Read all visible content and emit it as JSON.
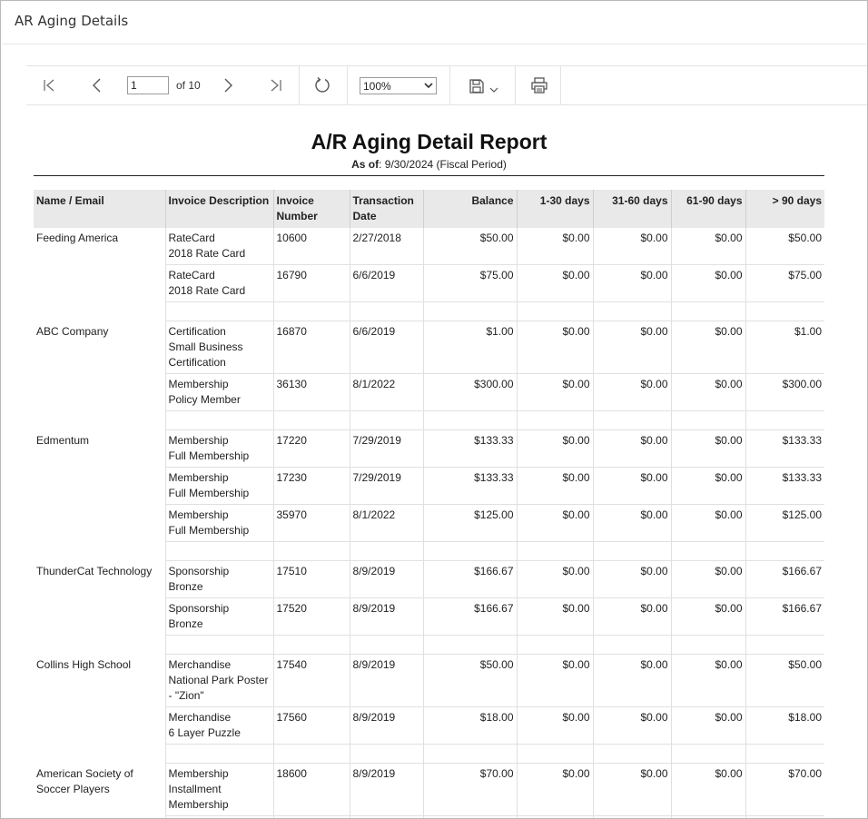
{
  "window": {
    "title": "AR Aging Details"
  },
  "toolbar": {
    "current_page": "1",
    "page_of": "of 10",
    "zoom": "100%",
    "icons": [
      "first-page-icon",
      "prev-page-icon",
      "next-page-icon",
      "last-page-icon",
      "refresh-icon",
      "save-icon",
      "chevron-down-icon",
      "print-icon"
    ]
  },
  "report": {
    "title": "A/R Aging Detail Report",
    "asof_label": "As of",
    "asof_value": ": 9/30/2024 (Fiscal Period)"
  },
  "table": {
    "headers": {
      "name": "Name / Email",
      "desc": "Invoice Description",
      "invoice_1": "Invoice",
      "invoice_2": "Number",
      "trans_1": "Transaction",
      "trans_2": "Date",
      "balance": "Balance",
      "d1_30": "1-30 days",
      "d31_60": "31-60 days",
      "d61_90": "61-90 days",
      "d90p": "> 90 days"
    },
    "groups": [
      {
        "name": "Feeding America",
        "rows": [
          {
            "desc": [
              "RateCard",
              "2018 Rate Card"
            ],
            "invoice": "10600",
            "date": "2/27/2018",
            "balance": "$50.00",
            "d1_30": "$0.00",
            "d31_60": "$0.00",
            "d61_90": "$0.00",
            "d90p": "$50.00"
          },
          {
            "desc": [
              "RateCard",
              "2018 Rate Card"
            ],
            "invoice": "16790",
            "date": "6/6/2019",
            "balance": "$75.00",
            "d1_30": "$0.00",
            "d31_60": "$0.00",
            "d61_90": "$0.00",
            "d90p": "$75.00"
          }
        ]
      },
      {
        "name": "ABC Company",
        "rows": [
          {
            "desc": [
              "Certification",
              "Small Business",
              "Certification"
            ],
            "invoice": "16870",
            "date": "6/6/2019",
            "balance": "$1.00",
            "d1_30": "$0.00",
            "d31_60": "$0.00",
            "d61_90": "$0.00",
            "d90p": "$1.00"
          },
          {
            "desc": [
              "Membership",
              "Policy Member"
            ],
            "invoice": "36130",
            "date": "8/1/2022",
            "balance": "$300.00",
            "d1_30": "$0.00",
            "d31_60": "$0.00",
            "d61_90": "$0.00",
            "d90p": "$300.00"
          }
        ]
      },
      {
        "name": "Edmentum",
        "rows": [
          {
            "desc": [
              "Membership",
              "Full Membership"
            ],
            "invoice": "17220",
            "date": "7/29/2019",
            "balance": "$133.33",
            "d1_30": "$0.00",
            "d31_60": "$0.00",
            "d61_90": "$0.00",
            "d90p": "$133.33"
          },
          {
            "desc": [
              "Membership",
              "Full Membership"
            ],
            "invoice": "17230",
            "date": "7/29/2019",
            "balance": "$133.33",
            "d1_30": "$0.00",
            "d31_60": "$0.00",
            "d61_90": "$0.00",
            "d90p": "$133.33"
          },
          {
            "desc": [
              "Membership",
              "Full Membership"
            ],
            "invoice": "35970",
            "date": "8/1/2022",
            "balance": "$125.00",
            "d1_30": "$0.00",
            "d31_60": "$0.00",
            "d61_90": "$0.00",
            "d90p": "$125.00"
          }
        ]
      },
      {
        "name": "ThunderCat Technology",
        "rows": [
          {
            "desc": [
              "Sponsorship",
              "Bronze"
            ],
            "invoice": "17510",
            "date": "8/9/2019",
            "balance": "$166.67",
            "d1_30": "$0.00",
            "d31_60": "$0.00",
            "d61_90": "$0.00",
            "d90p": "$166.67"
          },
          {
            "desc": [
              "Sponsorship",
              "Bronze"
            ],
            "invoice": "17520",
            "date": "8/9/2019",
            "balance": "$166.67",
            "d1_30": "$0.00",
            "d31_60": "$0.00",
            "d61_90": "$0.00",
            "d90p": "$166.67"
          }
        ]
      },
      {
        "name": "Collins High School",
        "rows": [
          {
            "desc": [
              "Merchandise",
              "National Park Poster",
              "- \"Zion\""
            ],
            "invoice": "17540",
            "date": "8/9/2019",
            "balance": "$50.00",
            "d1_30": "$0.00",
            "d31_60": "$0.00",
            "d61_90": "$0.00",
            "d90p": "$50.00"
          },
          {
            "desc": [
              "Merchandise",
              "6 Layer Puzzle"
            ],
            "invoice": "17560",
            "date": "8/9/2019",
            "balance": "$18.00",
            "d1_30": "$0.00",
            "d31_60": "$0.00",
            "d61_90": "$0.00",
            "d90p": "$18.00"
          }
        ]
      },
      {
        "name": "American Society of Soccer Players",
        "rows": [
          {
            "desc": [
              "Membership",
              "Installment",
              "Membership"
            ],
            "invoice": "18600",
            "date": "8/9/2019",
            "balance": "$70.00",
            "d1_30": "$0.00",
            "d31_60": "$0.00",
            "d61_90": "$0.00",
            "d90p": "$70.00"
          }
        ]
      }
    ]
  }
}
